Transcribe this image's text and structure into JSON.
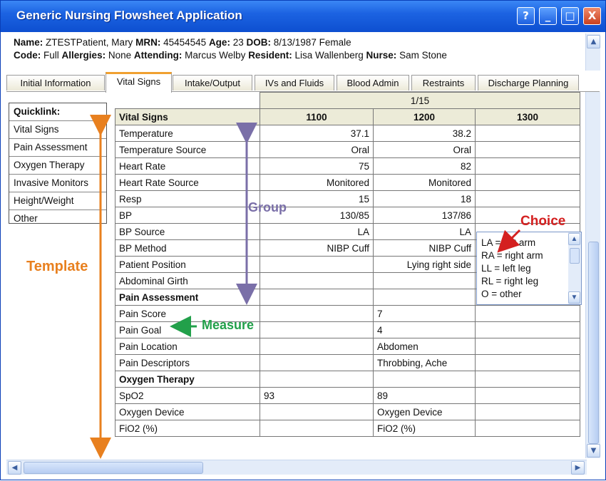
{
  "window": {
    "title": "Generic Nursing Flowsheet Application",
    "buttons": {
      "help": "?",
      "minimize": "_",
      "maximize": "□",
      "close": "X"
    }
  },
  "patient": {
    "name_label": "Name:",
    "name": "ZTESTPatient, Mary",
    "mrn_label": "MRN:",
    "mrn": "45454545",
    "age_label": "Age:",
    "age": "23",
    "dob_label": "DOB:",
    "dob": "8/13/1987 Female",
    "code_label": "Code:",
    "code": "Full",
    "allergies_label": "Allergies:",
    "allergies": "None",
    "attending_label": "Attending:",
    "attending": "Marcus Welby",
    "resident_label": "Resident:",
    "resident": "Lisa Wallenberg",
    "nurse_label": "Nurse:",
    "nurse": "Sam Stone"
  },
  "tabs": [
    "Initial Information",
    "Vital Signs",
    "Intake/Output",
    "IVs and Fluids",
    "Blood Admin",
    "Restraints",
    "Discharge Planning"
  ],
  "active_tab": "Vital Signs",
  "quicklink": {
    "header": "Quicklink:",
    "items": [
      "Vital Signs",
      "Pain Assessment",
      "Oxygen Therapy",
      "Invasive Monitors",
      "Height/Weight",
      "Other"
    ]
  },
  "grid": {
    "date": "1/15",
    "header_label": "Vital Signs",
    "times": [
      "1100",
      "1200",
      "1300"
    ],
    "rows": [
      {
        "label": "Temperature",
        "values": [
          "37.1",
          "38.2",
          ""
        ],
        "align": "right"
      },
      {
        "label": "Temperature Source",
        "values": [
          "Oral",
          "Oral",
          ""
        ],
        "align": "right"
      },
      {
        "label": "Heart Rate",
        "values": [
          "75",
          "82",
          ""
        ],
        "align": "right"
      },
      {
        "label": "Heart Rate Source",
        "values": [
          "Monitored",
          "Monitored",
          ""
        ],
        "align": "right"
      },
      {
        "label": "Resp",
        "values": [
          "15",
          "18",
          ""
        ],
        "align": "right"
      },
      {
        "label": "BP",
        "values": [
          "130/85",
          "137/86",
          ""
        ],
        "align": "right"
      },
      {
        "label": "BP Source",
        "values": [
          "LA",
          "LA",
          ""
        ],
        "align": "right"
      },
      {
        "label": "BP Method",
        "values": [
          "NIBP Cuff",
          "NIBP Cuff",
          ""
        ],
        "align": "right"
      },
      {
        "label": "Patient Position",
        "values": [
          "",
          "Lying right side",
          ""
        ],
        "align": "right"
      },
      {
        "label": "Abdominal Girth",
        "values": [
          "",
          "",
          ""
        ],
        "align": "right"
      },
      {
        "label": "Pain Assessment",
        "section": true,
        "values": [
          "",
          "",
          ""
        ]
      },
      {
        "label": "Pain Score",
        "values": [
          "",
          "7",
          ""
        ],
        "align": "left"
      },
      {
        "label": "Pain Goal",
        "values": [
          "",
          "4",
          ""
        ],
        "align": "left"
      },
      {
        "label": "Pain Location",
        "values": [
          "",
          "Abdomen",
          ""
        ],
        "align": "left"
      },
      {
        "label": "Pain Descriptors",
        "values": [
          "",
          "Throbbing, Ache",
          ""
        ],
        "align": "left"
      },
      {
        "label": "Oxygen Therapy",
        "section": true,
        "values": [
          "",
          "",
          ""
        ]
      },
      {
        "label": "SpO2",
        "values": [
          "93",
          "89",
          ""
        ],
        "align": "left"
      },
      {
        "label": "Oxygen Device",
        "values": [
          "",
          "Oxygen Device",
          ""
        ],
        "align": "left"
      },
      {
        "label": "FiO2 (%)",
        "values": [
          "",
          "FiO2 (%)",
          ""
        ],
        "align": "left"
      }
    ]
  },
  "choice_popup": {
    "options": [
      "LA = left arm",
      "RA = right arm",
      "LL = left leg",
      "RL = right leg",
      "O = other"
    ]
  },
  "annotations": {
    "template": "Template",
    "group": "Group",
    "choice": "Choice",
    "measure": "Measure"
  },
  "colors": {
    "titlebar": "#1c63e2",
    "template_annotation": "#e8801f",
    "group_annotation": "#7a6fa8",
    "choice_annotation": "#d42020",
    "measure_annotation": "#22a04a",
    "header_fill": "#ecebd8",
    "active_tab_accent": "#f0a030"
  },
  "icons": [
    "help-icon",
    "minimize-icon",
    "maximize-icon",
    "close-icon",
    "scroll-up-icon",
    "scroll-down-icon",
    "scroll-left-icon",
    "scroll-right-icon"
  ]
}
